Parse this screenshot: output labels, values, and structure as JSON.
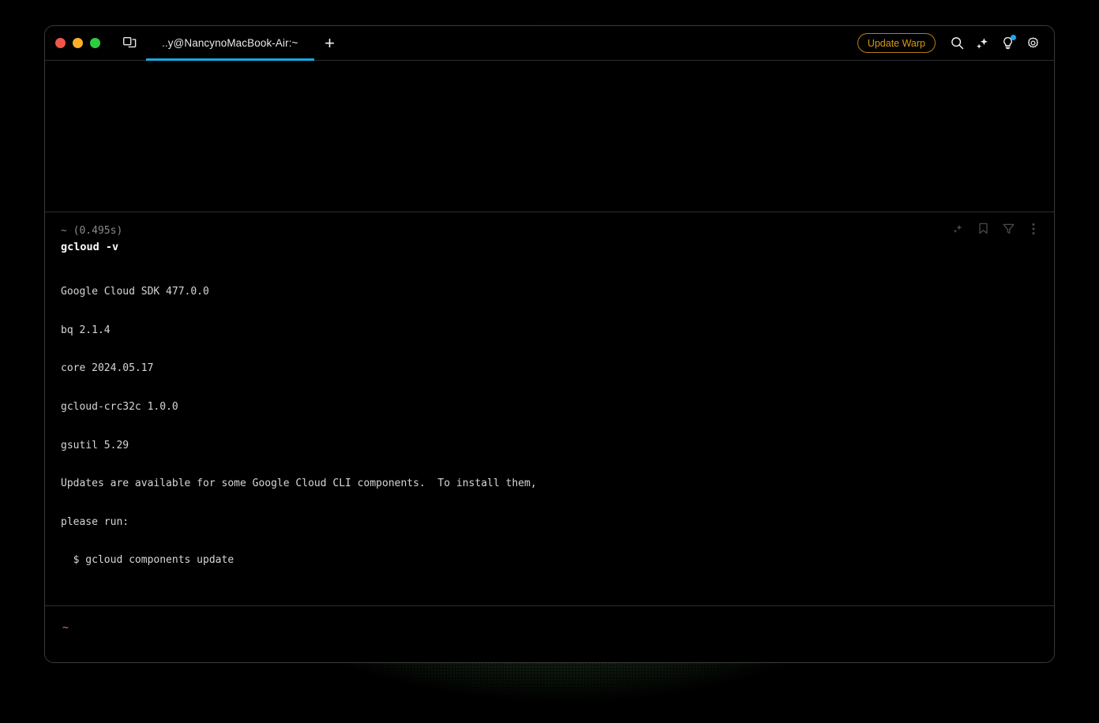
{
  "window": {
    "traffic_lights": [
      {
        "name": "close",
        "color": "#f2564a"
      },
      {
        "name": "minimize",
        "color": "#f9b028"
      },
      {
        "name": "maximize",
        "color": "#2ecc41"
      }
    ]
  },
  "titlebar": {
    "panes_icon": "split-panes-icon",
    "tabs": [
      {
        "label": "..y@NancynoMacBook-Air:~",
        "active": true
      }
    ],
    "new_tab_label": "+",
    "update_button_label": "Update Warp",
    "accent_underline": "#17a9e0",
    "update_accent": "#d59a17",
    "icons": [
      {
        "name": "search-icon"
      },
      {
        "name": "sparkle-icon"
      },
      {
        "name": "lightbulb-icon",
        "badge": true
      },
      {
        "name": "gear-icon"
      }
    ]
  },
  "block": {
    "prompt": "~ (0.495s)",
    "command": "gcloud -v",
    "output": [
      "Google Cloud SDK 477.0.0",
      "bq 2.1.4",
      "core 2024.05.17",
      "gcloud-crc32c 1.0.0",
      "gsutil 5.29",
      "Updates are available for some Google Cloud CLI components.  To install them,",
      "please run:",
      "  $ gcloud components update"
    ],
    "actions": [
      {
        "name": "sparkle-icon"
      },
      {
        "name": "bookmark-icon"
      },
      {
        "name": "filter-icon"
      },
      {
        "name": "more-options-icon"
      }
    ]
  },
  "input": {
    "prompt_symbol": "~",
    "prompt_color": "#d06cd0",
    "value": ""
  }
}
